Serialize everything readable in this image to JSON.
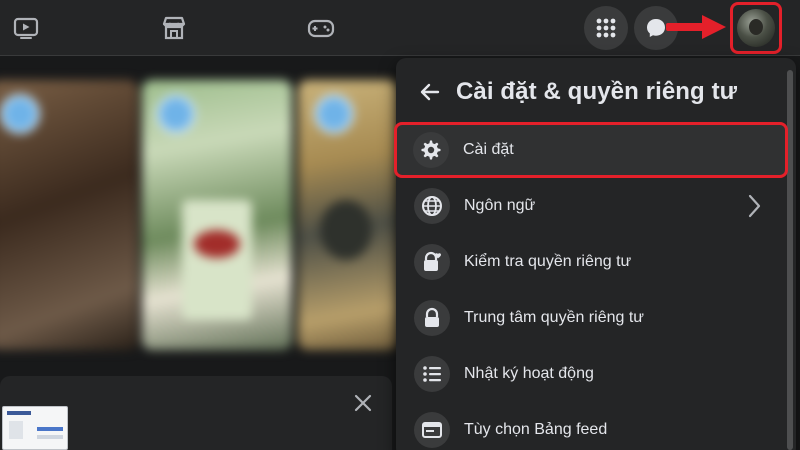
{
  "nav": {
    "icons": [
      "watch-icon",
      "marketplace-icon",
      "gaming-icon",
      "menu-grid-icon",
      "messenger-icon",
      "profile-avatar"
    ]
  },
  "panel": {
    "title": "Cài đặt & quyền riêng tư",
    "items": [
      {
        "label": "Cài đặt",
        "icon": "gear-icon",
        "highlighted": true
      },
      {
        "label": "Ngôn ngữ",
        "icon": "globe-icon",
        "has_submenu": true
      },
      {
        "label": "Kiểm tra quyền riêng tư",
        "icon": "lock-heart-icon"
      },
      {
        "label": "Trung tâm quyền riêng tư",
        "icon": "lock-icon"
      },
      {
        "label": "Nhật ký hoạt động",
        "icon": "list-icon"
      },
      {
        "label": "Tùy chọn Bảng feed",
        "icon": "feed-icon"
      }
    ]
  },
  "colors": {
    "background": "#18191a",
    "surface": "#242526",
    "icon_bg": "#3a3b3c",
    "text": "#e4e6eb",
    "annotation_red": "#e4202a"
  }
}
